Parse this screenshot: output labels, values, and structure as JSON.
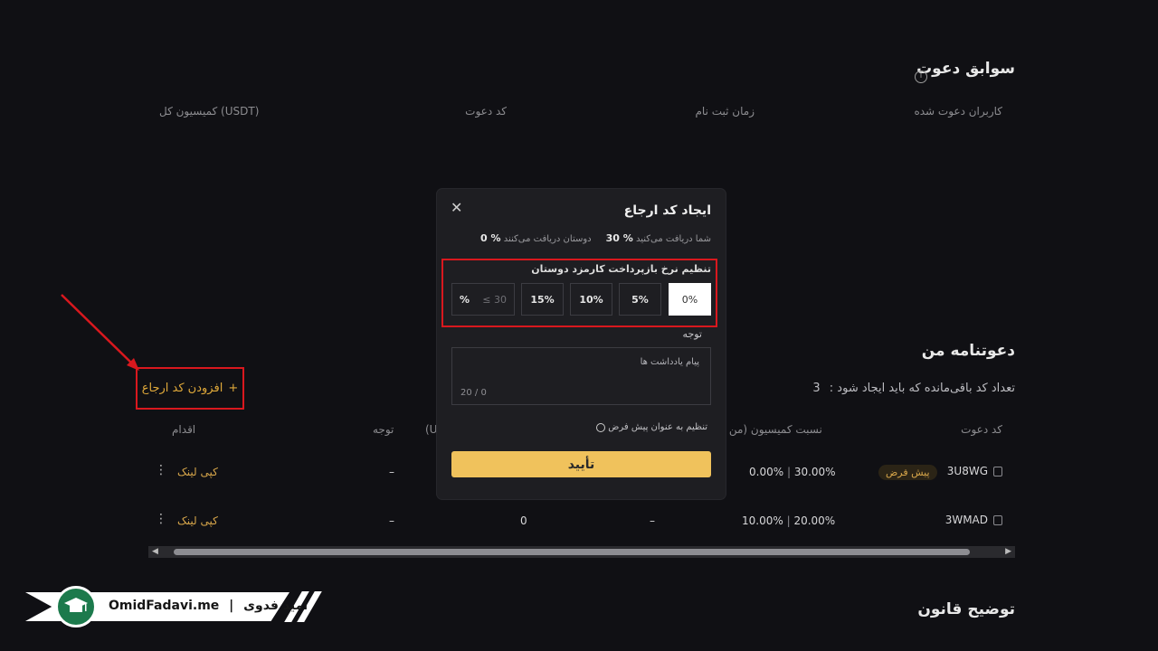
{
  "history": {
    "title": "سوابق دعوت",
    "columns": [
      "کاربران دعوت شده",
      "زمان ثبت نام",
      "کد دعوت",
      "کمیسیون کل (USDT)"
    ]
  },
  "invites": {
    "title": "دعوتنامه من",
    "remaining_label": "تعداد کد باقی‌مانده که باید ایجاد شود :",
    "remaining_value": "3",
    "add_button": "افزودن کد ارجاع",
    "columns": {
      "code": "کد دعوت",
      "ratio": "نسبت کمیسیون (من |",
      "partial": "(U",
      "note": "توجه",
      "action": "اقدام"
    },
    "rows": [
      {
        "code": "3U8WG",
        "badge": "پیش فرض",
        "ratio_mine": "30.00%",
        "ratio_friend": "0.00%",
        "note": "–",
        "action": "کپی لینک"
      },
      {
        "code": "3WMAD",
        "badge": "",
        "ratio_mine": "20.00%",
        "ratio_friend": "10.00%",
        "dash": "–",
        "count": "0",
        "note": "–",
        "action": "کپی لینک"
      }
    ]
  },
  "rules": {
    "title": "توضیح قانون"
  },
  "watermark": {
    "site": "OmidFadavi.me",
    "name": "امید فدوی"
  },
  "modal": {
    "title": "ایجاد کد ارجاع",
    "you_receive_label": "شما دریافت می‌کنید",
    "you_receive_value": "30 %",
    "friend_receive_label": "دوستان دریافت می‌کنند",
    "friend_receive_value": "0 %",
    "rate_label": "تنظیم نرخ بازپرداخت کارمزد دوستان",
    "options": [
      "0%",
      "5%",
      "10%",
      "15%"
    ],
    "custom_placeholder": "≤ 30",
    "custom_unit": "%",
    "note_label": "توجه",
    "note_placeholder": "پیام یادداشت ها",
    "note_count": "20 / 0",
    "default_label": "تنظیم به عنوان پیش فرض",
    "confirm": "تأیید"
  },
  "colors": {
    "accent": "#f0c25c",
    "highlight": "#d9181e",
    "gold_text": "#d7a64a"
  }
}
